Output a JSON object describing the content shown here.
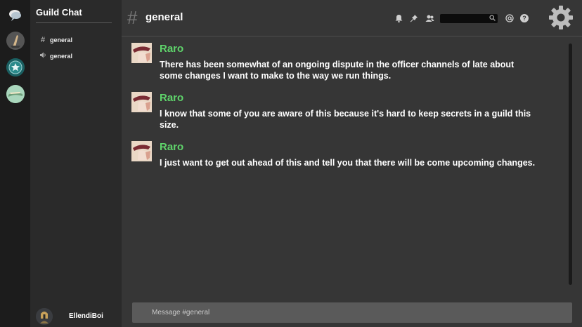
{
  "sidebar": {
    "guild_title": "Guild Chat",
    "channels": [
      {
        "name": "general",
        "type": "text",
        "icon": "hash-icon"
      },
      {
        "name": "general",
        "type": "voice",
        "icon": "speaker-icon"
      }
    ],
    "user": {
      "name": "EllendiBoi"
    }
  },
  "header": {
    "channel_name": "general",
    "search": {
      "value": ""
    },
    "icons": [
      "bell-icon",
      "pin-icon",
      "members-icon",
      "mention-icon",
      "help-icon",
      "settings-gear-icon"
    ]
  },
  "messages": [
    {
      "author": "Raro",
      "text": "There has been somewhat of an ongoing dispute in the officer channels of late about some changes I want to make to the way we run things."
    },
    {
      "author": "Raro",
      "text": "I know that some of you are aware of this because it's hard to keep secrets in a guild this size."
    },
    {
      "author": "Raro",
      "text": "I just want to get out ahead of this and tell you that there will be come upcoming changes."
    }
  ],
  "composer": {
    "placeholder": "Message #general"
  },
  "colors": {
    "author": "#5fd46b",
    "background": "#363636",
    "sidebar": "#2a2a2a",
    "rail": "#1c1c1c"
  }
}
